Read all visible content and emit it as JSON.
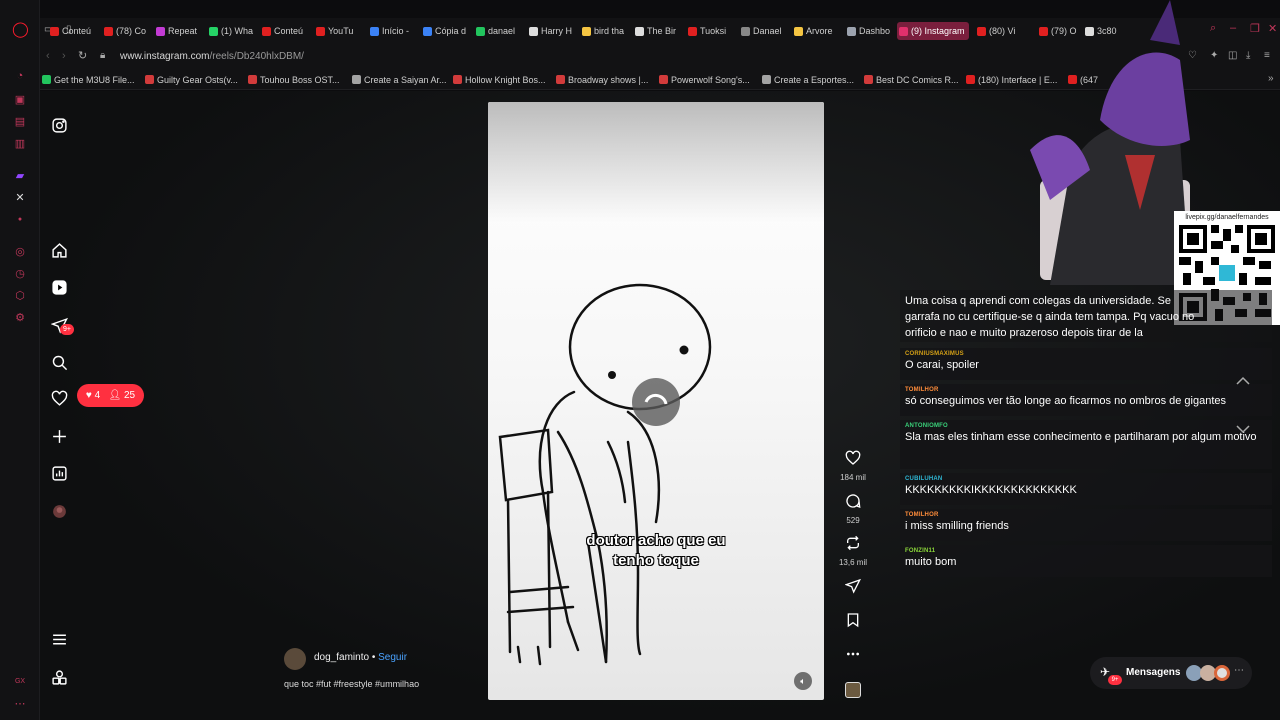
{
  "browser": {
    "tabs": [
      {
        "label": "Conteú",
        "color": "#e02020"
      },
      {
        "label": "(78) Co",
        "color": "#e02020"
      },
      {
        "label": "Repeat",
        "color": "#c23bd4"
      },
      {
        "label": "(1) Wha",
        "color": "#25d366"
      },
      {
        "label": "Conteú",
        "color": "#e02020"
      },
      {
        "label": "YouTu",
        "color": "#e02020"
      },
      {
        "label": "Início -",
        "color": "#3b82f6"
      },
      {
        "label": "Cópia d",
        "color": "#3b82f6"
      },
      {
        "label": "danael",
        "color": "#22c55e"
      },
      {
        "label": "Harry H",
        "color": "#dddddd"
      },
      {
        "label": "bird tha",
        "color": "#f5c542"
      },
      {
        "label": "The Bir",
        "color": "#dddddd"
      },
      {
        "label": "Tuoksi",
        "color": "#e02020"
      },
      {
        "label": "Danael",
        "color": "#888888"
      },
      {
        "label": "Arvore",
        "color": "#f5c542"
      },
      {
        "label": "Dashbo",
        "color": "#9ca3af"
      },
      {
        "label": "(9) Instagram",
        "color": "#e1306c",
        "active": true
      },
      {
        "label": "(80) Vi",
        "color": "#e02020"
      },
      {
        "label": "(79) O",
        "color": "#e02020"
      },
      {
        "label": "3c80",
        "color": "#dddddd"
      }
    ],
    "url_host": "www.instagram.com",
    "url_path": "/reels/Db240hlxDBM/",
    "bookmarks": [
      {
        "label": "Get the M3U8 File...",
        "color": "#22c55e"
      },
      {
        "label": "Guilty Gear Osts(v...",
        "color": "#d23b3b"
      },
      {
        "label": "Touhou Boss OST...",
        "color": "#d23b3b"
      },
      {
        "label": "Create a Saiyan Ar...",
        "color": "#a3a3a3"
      },
      {
        "label": "Hollow Knight Bos...",
        "color": "#d23b3b"
      },
      {
        "label": "Broadway shows |...",
        "color": "#d23b3b"
      },
      {
        "label": "Powerwolf Song's...",
        "color": "#d23b3b"
      },
      {
        "label": "Create a Esportes...",
        "color": "#a3a3a3"
      },
      {
        "label": "Best DC Comics R...",
        "color": "#d23b3b"
      },
      {
        "label": "(180) Interface | E...",
        "color": "#e02020"
      },
      {
        "label": "(647",
        "color": "#e02020"
      }
    ]
  },
  "instagram": {
    "notifications_badge": "9+",
    "likes_count": "4",
    "followers_count": "25",
    "reel": {
      "caption_line1": "doutor acho que eu",
      "caption_line2": "tenho toque",
      "likes": "184 mil",
      "comments": "529",
      "reposts": "13,6 mil",
      "author": "dog_faminto",
      "follow_label": "Seguir",
      "separator": "•",
      "description": "que toc #fut #freestyle #ummilhao"
    },
    "messages_label": "Mensagens",
    "messages_badge": "9+"
  },
  "stream": {
    "qr_label": "livepix.gg/danaelfernandes",
    "chat": [
      {
        "user": "",
        "text": "Uma coisa q aprendi com colegas da universidade. Se garrafa no cu certifique-se q ainda tem tampa. Pq vacuo no orificio e nao e muito prazeroso depois tirar de la",
        "color": "#ffffff"
      },
      {
        "user": "CORNIUSMAXIMUS",
        "text": "O carai, spoiler",
        "color": "#d4a017"
      },
      {
        "user": "TOMILHOR",
        "text": "só conseguimos ver tão longe ao ficarmos no ombros de gigantes",
        "color": "#ff8c3a"
      },
      {
        "user": "ANTONIOMFO",
        "text": "Sla mas eles tinham esse conhecimento e partilharam por algum motivo",
        "color": "#3ad17a"
      },
      {
        "user": "CUBILUHAN",
        "text": "KKKKKKKKKIKKKKKKKKKKKKKK",
        "color": "#2fb8d6"
      },
      {
        "user": "TOMILHOR",
        "text": "i miss smilling friends",
        "color": "#ff8c3a"
      },
      {
        "user": "FONZIN11",
        "text": "muito bom",
        "color": "#8bd83a"
      }
    ]
  }
}
